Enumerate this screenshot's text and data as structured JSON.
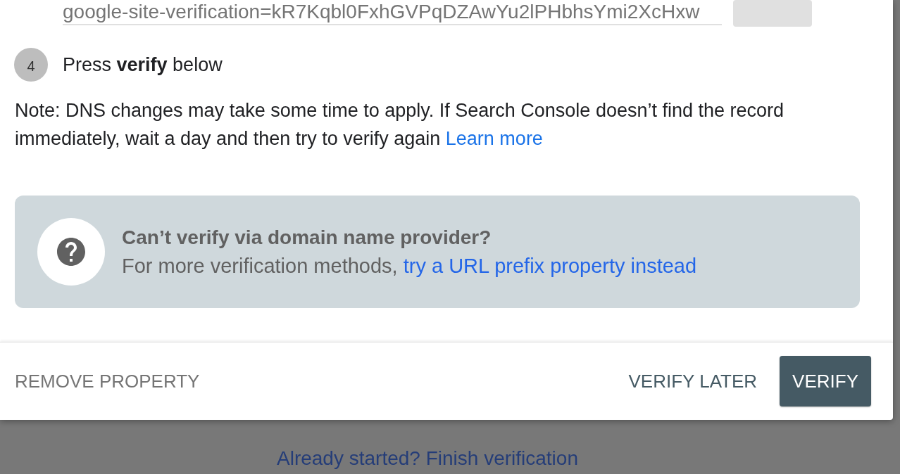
{
  "verification_record": {
    "value": "google-site-verification=kR7Kqbl0FxhGVPqDZAwYu2lPHbhsYmi2XcHxw"
  },
  "steps": [
    {
      "number": "4",
      "text": "Press **verify** below"
    }
  ],
  "note": {
    "text": "Note: DNS changes may take some time to apply. If Search Console doesn’t find the record immediately, wait a day and then try to verify again",
    "link": "Learn more"
  },
  "help_box": {
    "title": "Can’t verify via domain name provider?",
    "text": "For more verification methods,",
    "link": "try a URL prefix property instead"
  },
  "footer": {
    "buttons": [
      {
        "label": "REMOVE PROPERTY",
        "kind": "plain-muted"
      },
      {
        "label": "VERIFY LATER",
        "kind": "plain"
      },
      {
        "label": "VERIFY",
        "kind": "filled"
      }
    ]
  },
  "background_link": "Already started? Finish verification"
}
